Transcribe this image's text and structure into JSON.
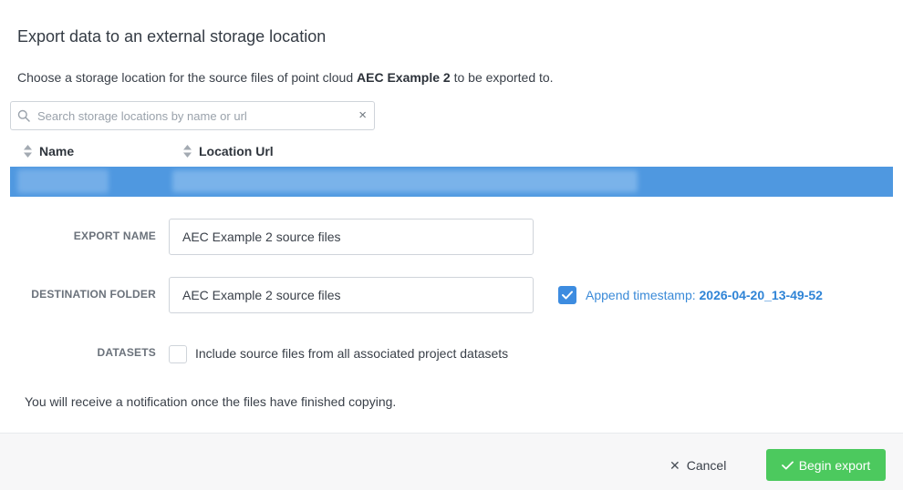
{
  "dialog": {
    "title": "Export data to an external storage location",
    "desc_prefix": "Choose a storage location for the source files of point cloud ",
    "desc_bold": "AEC Example 2",
    "desc_suffix": " to be exported to."
  },
  "search": {
    "placeholder": "Search storage locations by name or url",
    "value": "",
    "clear_glyph": "×"
  },
  "table": {
    "columns": [
      "Name",
      "Location Url"
    ],
    "selected_row": {
      "name": "",
      "url": ""
    }
  },
  "form": {
    "export_name_label": "EXPORT NAME",
    "export_name_value": "AEC Example 2 source files",
    "destination_label": "DESTINATION FOLDER",
    "destination_value": "AEC Example 2 source files",
    "append_timestamp_checked": true,
    "append_timestamp_label": "Append timestamp: ",
    "timestamp_value": "2026-04-20_13-49-52",
    "datasets_label": "DATASETS",
    "datasets_checked": false,
    "datasets_option": "Include source files from all associated project datasets"
  },
  "notice": "You will receive a notification once the files have finished copying.",
  "footer": {
    "cancel_label": "Cancel",
    "cancel_glyph": "✕",
    "begin_label": "Begin export"
  },
  "colors": {
    "selected_row": "#4f98e0",
    "accent": "#3d8ce0",
    "primary_button": "#4cc95e"
  }
}
